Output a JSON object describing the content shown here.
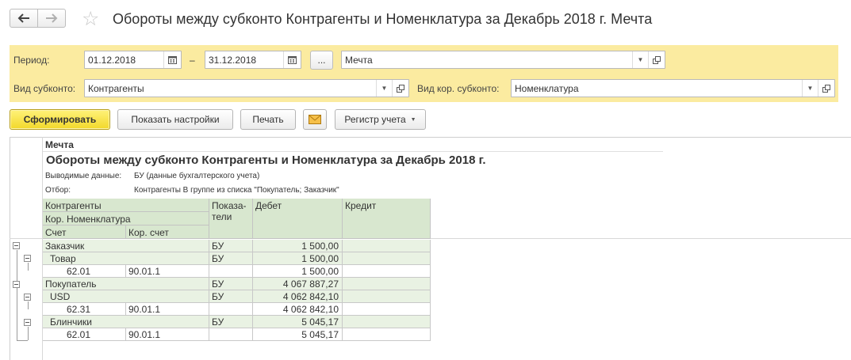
{
  "header": {
    "title": "Обороты между субконто Контрагенты и Номенклатура за Декабрь 2018 г. Мечта",
    "back_icon": "arrow-left-icon",
    "forward_icon": "arrow-right-icon",
    "favorite_icon": "star-icon"
  },
  "filters": {
    "period_label": "Период:",
    "date_from": "01.12.2018",
    "period_dash": "–",
    "date_to": "31.12.2018",
    "ellipsis_label": "...",
    "organization": "Мечта",
    "subconto_label": "Вид субконто:",
    "subconto_value": "Контрагенты",
    "kor_subconto_label": "Вид кор. субконто:",
    "kor_subconto_value": "Номенклатура"
  },
  "toolbar": {
    "generate_label": "Сформировать",
    "settings_label": "Показать настройки",
    "print_label": "Печать",
    "mail_icon": "envelope-icon",
    "register_label": "Регистр учета"
  },
  "report": {
    "company": "Мечта",
    "title": "Обороты между субконто Контрагенты и Номенклатура за Декабрь 2018 г.",
    "output_label": "Выводимые данные:",
    "output_value": "БУ (данные бухгалтерского учета)",
    "filter_label": "Отбор:",
    "filter_value": "Контрагенты В группе из списка \"Покупатель; Заказчик\"",
    "columns": {
      "contractors": "Контрагенты",
      "kor_nomenclature": "Кор. Номенклатура",
      "account": "Счет",
      "kor_account": "Кор. счет",
      "indicators_line1": "Показа-",
      "indicators_line2": "тели",
      "debit": "Дебет",
      "credit": "Кредит"
    },
    "rows": [
      {
        "name": "Заказчик",
        "indicator": "БУ",
        "debit": "1 500,00"
      },
      {
        "name": "Товар",
        "indicator": "БУ",
        "debit": "1 500,00"
      },
      {
        "account": "62.01",
        "kor_account": "90.01.1",
        "debit": "1 500,00"
      },
      {
        "name": "Покупатель",
        "indicator": "БУ",
        "debit": "4 067 887,27"
      },
      {
        "name": "USD",
        "indicator": "БУ",
        "debit": "4 062 842,10"
      },
      {
        "account": "62.31",
        "kor_account": "90.01.1",
        "debit": "4 062 842,10"
      },
      {
        "name": "Блинчики",
        "indicator": "БУ",
        "debit": "5 045,17"
      },
      {
        "account": "62.01",
        "kor_account": "90.01.1",
        "debit": "5 045,17"
      }
    ]
  },
  "colors": {
    "filter_panel": "#fbeba0",
    "primary_button": "#f2d82a",
    "header_cells": "#d8e7cf",
    "group_rows": "#e9f2e3"
  }
}
